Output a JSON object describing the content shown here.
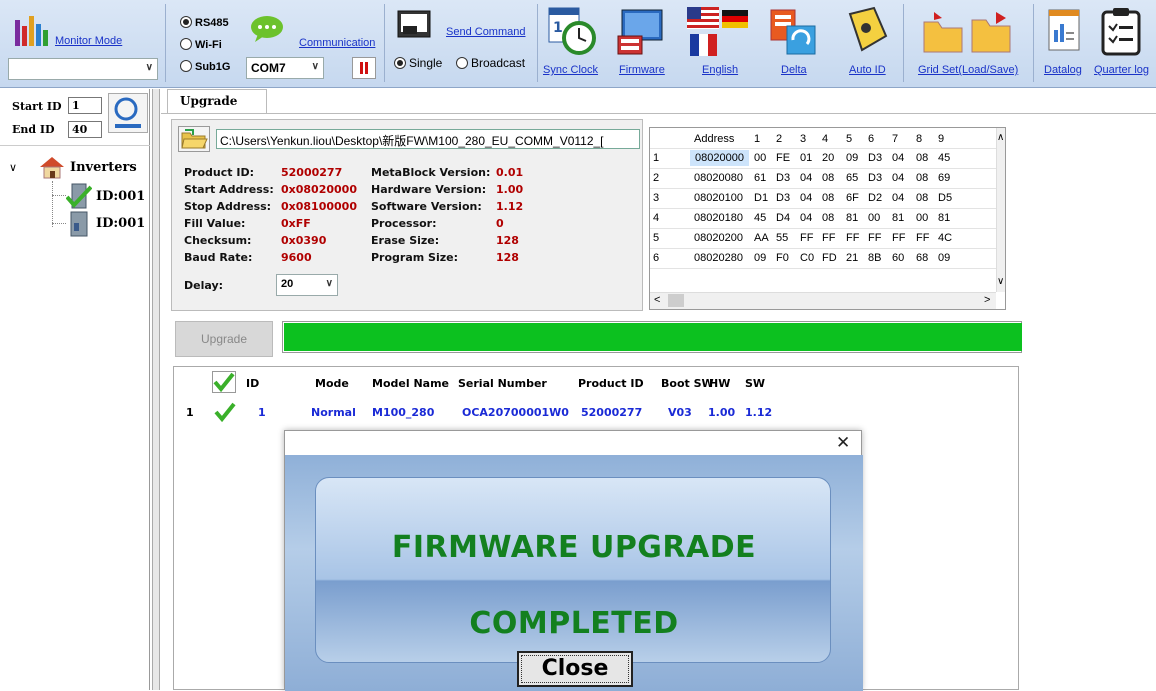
{
  "toolbar": {
    "monitor_mode": "Monitor Mode",
    "comm": {
      "rs485": "RS485",
      "wifi": "Wi-Fi",
      "sub1g": "Sub1G",
      "port": "COM7",
      "communication": "Communication"
    },
    "send_command": "Send Command",
    "single": "Single",
    "broadcast": "Broadcast",
    "sync_clock": "Sync Clock",
    "firmware": "Firmware",
    "english": "English",
    "delta": "Delta",
    "auto_id": "Auto ID",
    "grid_set": "Grid Set(Load/Save)",
    "datalog": "Datalog",
    "quarter_log": "Quarter log"
  },
  "left": {
    "start_id_label": "Start ID",
    "start_id_value": "1",
    "end_id_label": "End ID",
    "end_id_value": "40",
    "tree_root": "Inverters",
    "tree_items": [
      "ID:001",
      "ID:001"
    ]
  },
  "main": {
    "tab_label": "Upgrade",
    "file_path": "C:\\Users\\Yenkun.liou\\Desktop\\新版FW\\M100_280_EU_COMM_V0112_[",
    "info": {
      "product_id_label": "Product ID:",
      "product_id": "52000277",
      "start_addr_label": "Start Address:",
      "start_addr": "0x08020000",
      "stop_addr_label": "Stop Address:",
      "stop_addr": "0x08100000",
      "fill_label": "Fill Value:",
      "fill": "0xFF",
      "checksum_label": "Checksum:",
      "checksum": "0x0390",
      "baud_label": "Baud Rate:",
      "baud": "9600",
      "metablock_label": "MetaBlock Version:",
      "metablock": "0.01",
      "hw_label": "Hardware Version:",
      "hw": "1.00",
      "sw_label": "Software Version:",
      "sw": "1.12",
      "processor_label": "Processor:",
      "processor": "0",
      "erase_label": "Erase Size:",
      "erase": "128",
      "program_label": "Program Size:",
      "program": "128",
      "delay_label": "Delay:",
      "delay": "20"
    },
    "hex": {
      "headers": [
        "Address",
        "1",
        "2",
        "3",
        "4",
        "5",
        "6",
        "7",
        "8",
        "9"
      ],
      "rows": [
        {
          "n": "1",
          "addr": "08020000",
          "b": [
            "00",
            "FE",
            "01",
            "20",
            "09",
            "D3",
            "04",
            "08",
            "45"
          ]
        },
        {
          "n": "2",
          "addr": "08020080",
          "b": [
            "61",
            "D3",
            "04",
            "08",
            "65",
            "D3",
            "04",
            "08",
            "69"
          ]
        },
        {
          "n": "3",
          "addr": "08020100",
          "b": [
            "D1",
            "D3",
            "04",
            "08",
            "6F",
            "D2",
            "04",
            "08",
            "D5"
          ]
        },
        {
          "n": "4",
          "addr": "08020180",
          "b": [
            "45",
            "D4",
            "04",
            "08",
            "81",
            "00",
            "81",
            "00",
            "81"
          ]
        },
        {
          "n": "5",
          "addr": "08020200",
          "b": [
            "AA",
            "55",
            "FF",
            "FF",
            "FF",
            "FF",
            "FF",
            "FF",
            "4C"
          ]
        },
        {
          "n": "6",
          "addr": "08020280",
          "b": [
            "09",
            "F0",
            "C0",
            "FD",
            "21",
            "8B",
            "60",
            "68",
            "09"
          ]
        }
      ]
    },
    "upgrade_button": "Upgrade",
    "progress": 1.0,
    "list": {
      "headers": [
        "ID",
        "Mode",
        "Model Name",
        "Serial Number",
        "Product ID",
        "Boot SW",
        "HW",
        "SW"
      ],
      "rows": [
        {
          "n": "1",
          "id": "1",
          "mode": "Normal",
          "model": "M100_280",
          "serial": "OCA20700001W0",
          "product": "52000277",
          "boot": "V03",
          "hw": "1.00",
          "sw": "1.12"
        }
      ]
    }
  },
  "dialog": {
    "line1": "FIRMWARE UPGRADE",
    "line2": "COMPLETED",
    "close": "Close"
  },
  "colors": {
    "progress_fill": "#0cc11f",
    "info_values": "#b00000",
    "list_values": "#1a2ad6",
    "dialog_text": "#13801f"
  }
}
